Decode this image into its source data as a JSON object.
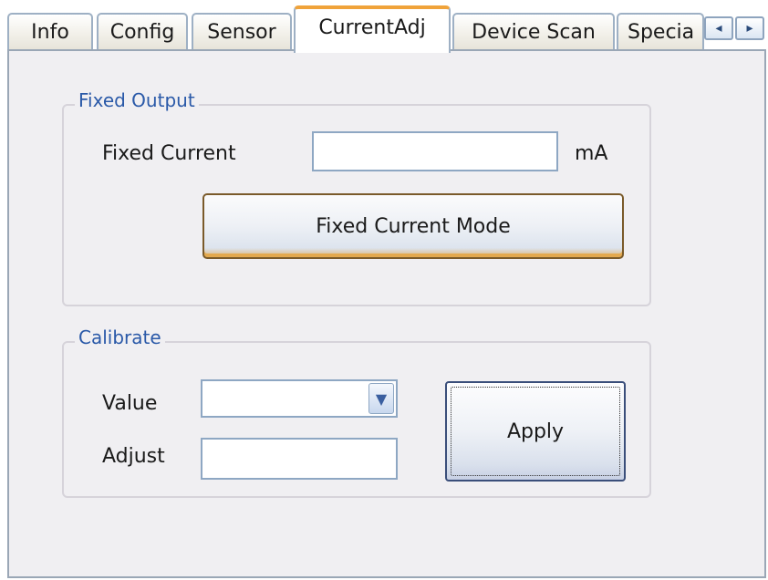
{
  "tabs": [
    {
      "label": "Info",
      "active": false
    },
    {
      "label": "Config",
      "active": false
    },
    {
      "label": "Sensor",
      "active": false
    },
    {
      "label": "CurrentAdj",
      "active": true
    },
    {
      "label": "Device Scan",
      "active": false
    },
    {
      "label": "Specia",
      "active": false
    }
  ],
  "tab_scroll": {
    "left_icon": "◂",
    "right_icon": "▸"
  },
  "fixed_output": {
    "legend": "Fixed Output",
    "current_label": "Fixed Current",
    "current_value": "",
    "unit": "mA",
    "mode_button": "Fixed Current Mode"
  },
  "calibrate": {
    "legend": "Calibrate",
    "value_label": "Value",
    "value_selected": "",
    "adjust_label": "Adjust",
    "adjust_value": "",
    "apply_button": "Apply"
  },
  "colors": {
    "active_tab_accent": "#f0a33a",
    "group_legend": "#2a59a8",
    "panel_background": "#f0eff2"
  }
}
